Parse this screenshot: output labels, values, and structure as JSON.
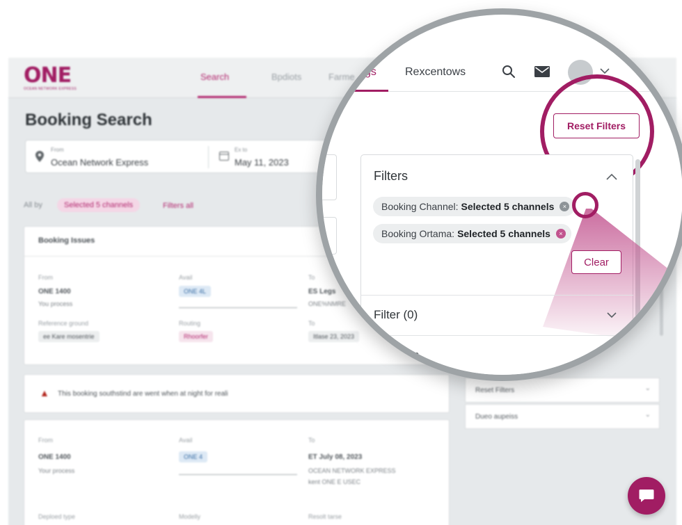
{
  "colors": {
    "brand": "#a11d63",
    "accent_light": "#f4d7e6",
    "warning": "#b3261e"
  },
  "background_app": {
    "logo": {
      "text": "ONE",
      "subtitle": "OCEAN NETWORK EXPRESS"
    },
    "nav": [
      {
        "label": "Search",
        "active": true
      },
      {
        "label": "Bpdiots",
        "active": false
      },
      {
        "label": "Farme",
        "active": false
      }
    ],
    "page_title": "Booking Search",
    "search": {
      "from_label": "From",
      "from_value": "Ocean Network Express",
      "to_label": "Ex to",
      "to_value": "May 11, 2023"
    },
    "filter_bar": {
      "prefix": "All by",
      "chip": "Selected 5 channels",
      "link": "Filters all"
    },
    "card1": {
      "title": "Booking Issues",
      "from_label": "From",
      "from_value": "ONE 1400",
      "from_sub": "You process",
      "avail_label": "Avail",
      "avail_value": "ONE 4L",
      "to_label": "To",
      "to_value": "ES Legs",
      "to_sub": "ONE%NMRE",
      "extra1_label": "Reference ground",
      "extra1_value": "ee Kare mosentrie",
      "extra2_label": "Routing",
      "extra2_value": "Rhoorfer",
      "extra3_label": "To",
      "extra3_value": "Itlase 23, 2023"
    },
    "alert": {
      "icon": "warning-icon",
      "text": "This booking southstind are went when at night for reali"
    },
    "card2": {
      "from_label": "From",
      "from_value": "ONE 1400",
      "from_sub": "Your process",
      "avail_label": "Avail",
      "avail_value": "ONE 4",
      "to_label": "To",
      "to_value": "ET July 08, 2023",
      "to_sub": "OCEAN NETWORK EXPRESS",
      "to_sub2": "kent ONE E USEC",
      "f1": "Deploed type",
      "f2": "Modelly",
      "f3": "Resolt tarse"
    },
    "side_rows": [
      "Reset Filters",
      "Dueo aupeiss"
    ]
  },
  "lens": {
    "tabs": [
      {
        "label": "gs",
        "active": true
      },
      {
        "label": "Rexcentows",
        "active": false
      }
    ],
    "icons": [
      "search-icon",
      "mail-icon",
      "avatar-icon",
      "chevron-down-icon"
    ],
    "reset_filters_button": "Reset Filters",
    "filters_panel": {
      "title": "Filters",
      "chips": [
        {
          "label": "Booking Channel:",
          "value": "Selected 5 channels"
        },
        {
          "label": "Booking Ortama:",
          "value": "Selected 5 channels"
        }
      ],
      "clear_button": "Clear"
    },
    "filter_row": "Filter (0)",
    "reset_row": "et Filters"
  }
}
